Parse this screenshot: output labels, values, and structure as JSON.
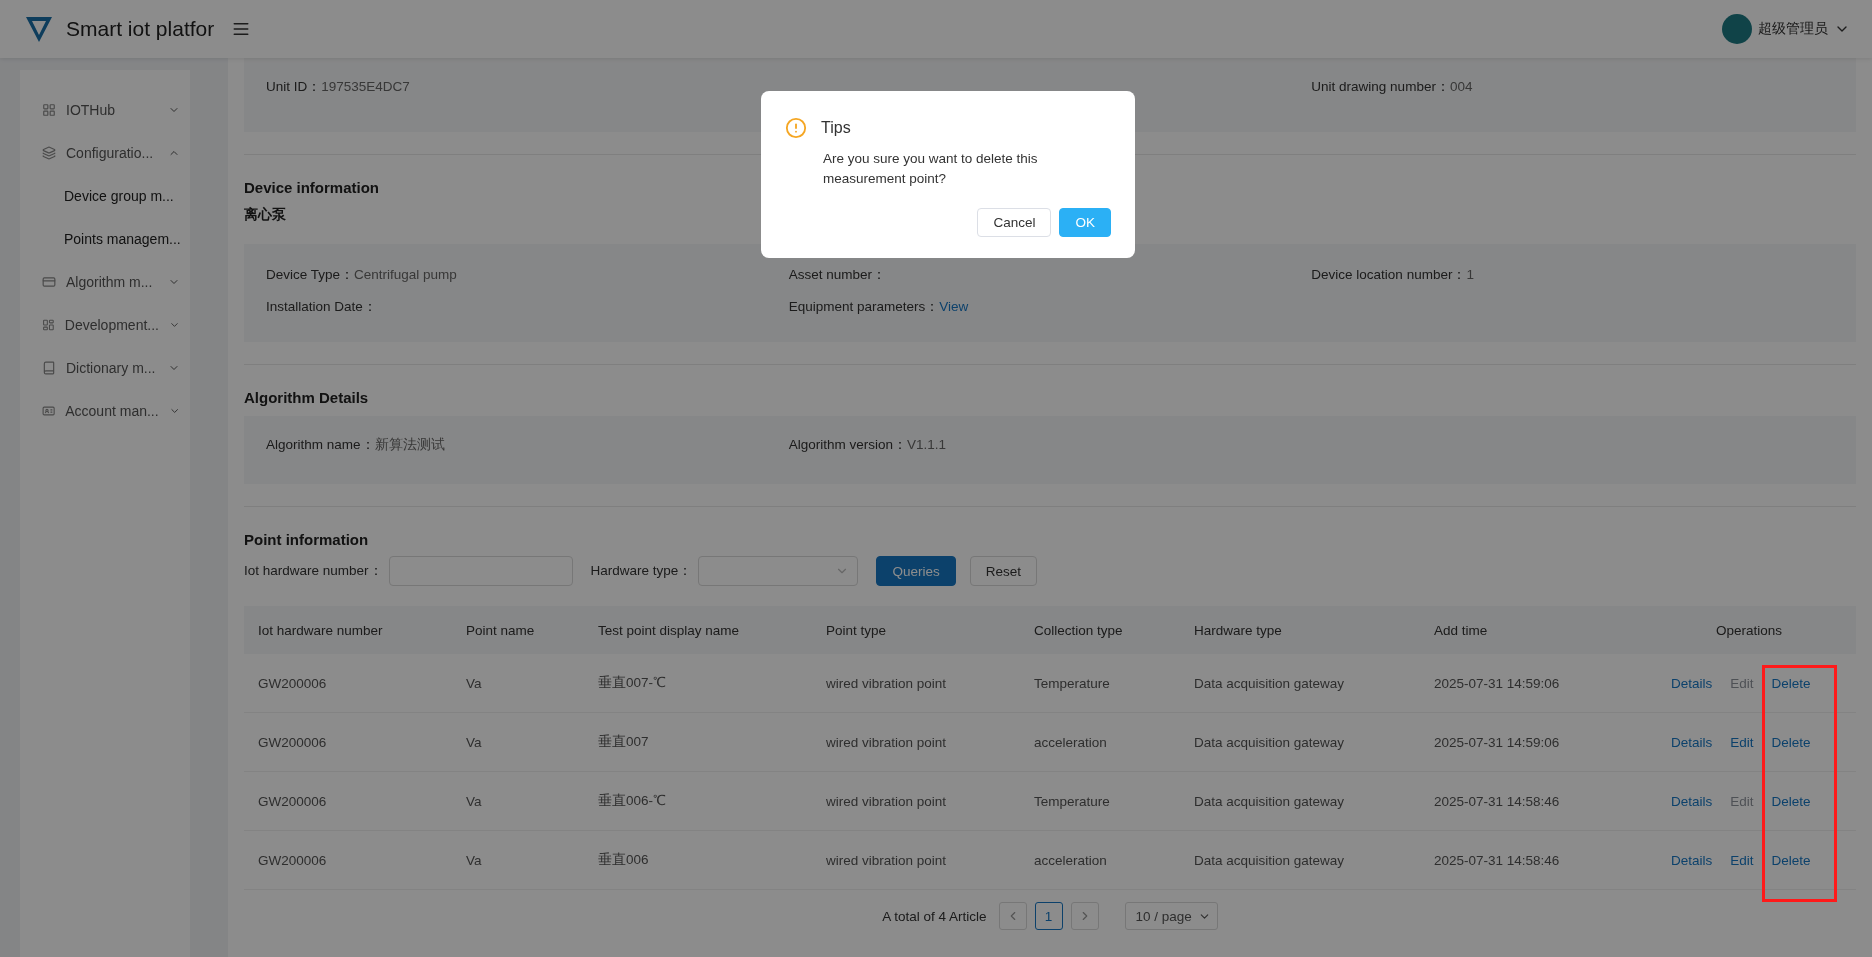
{
  "header": {
    "title": "Smart iot platfor",
    "user": "超级管理员"
  },
  "sidebar": {
    "items": [
      {
        "label": "IOTHub",
        "expanded": false
      },
      {
        "label": "Configuratio...",
        "expanded": true,
        "children": [
          {
            "label": "Device group m..."
          },
          {
            "label": "Points managem..."
          }
        ]
      },
      {
        "label": "Algorithm m...",
        "expanded": false
      },
      {
        "label": "Development...",
        "expanded": false
      },
      {
        "label": "Dictionary m...",
        "expanded": false
      },
      {
        "label": "Account man...",
        "expanded": false
      }
    ]
  },
  "unit": {
    "fields": [
      {
        "label": "Unit ID：",
        "value": "197535E4DC7"
      },
      {
        "label": "Unit drawing number：",
        "value": "004"
      }
    ]
  },
  "device": {
    "heading": "Device information",
    "name": "离心泵",
    "fields": [
      {
        "label": "Device Type：",
        "value": "Centrifugal pump"
      },
      {
        "label": "Asset number："
      },
      {
        "label": "Device location number：",
        "value": "1"
      },
      {
        "label": "Installation Date："
      },
      {
        "label": "Equipment parameters：",
        "link": "View"
      }
    ]
  },
  "algorithm": {
    "heading": "Algorithm Details",
    "fields": [
      {
        "label": "Algorithm name：",
        "value": "新算法测试"
      },
      {
        "label": "Algorithm version：",
        "value": "V1.1.1"
      }
    ]
  },
  "points": {
    "heading": "Point information",
    "filters": [
      {
        "label": "Iot hardware number：",
        "kind": "input"
      },
      {
        "label": "Hardware type：",
        "kind": "select"
      }
    ],
    "buttons": [
      {
        "label": "Queries",
        "kind": "primary"
      },
      {
        "label": "Reset",
        "kind": "default"
      }
    ],
    "table": {
      "columns": [
        "Iot hardware number",
        "Point name",
        "Test point display name",
        "Point type",
        "Collection type",
        "Hardware type",
        "Add time",
        "Operations"
      ],
      "rows": [
        {
          "cells": [
            "GW200006",
            "Va",
            "垂直007-℃",
            "wired vibration point",
            "Temperature",
            "Data acquisition gateway",
            "2025-07-31 14:59:06"
          ],
          "actions": [
            {
              "label": "Details",
              "disabled": false
            },
            {
              "label": "Edit",
              "disabled": true
            },
            {
              "label": "Delete",
              "disabled": false
            }
          ]
        },
        {
          "cells": [
            "GW200006",
            "Va",
            "垂直007",
            "wired vibration point",
            "acceleration",
            "Data acquisition gateway",
            "2025-07-31 14:59:06"
          ],
          "actions": [
            {
              "label": "Details",
              "disabled": false
            },
            {
              "label": "Edit",
              "disabled": false
            },
            {
              "label": "Delete",
              "disabled": false
            }
          ]
        },
        {
          "cells": [
            "GW200006",
            "Va",
            "垂直006-℃",
            "wired vibration point",
            "Temperature",
            "Data acquisition gateway",
            "2025-07-31 14:58:46"
          ],
          "actions": [
            {
              "label": "Details",
              "disabled": false
            },
            {
              "label": "Edit",
              "disabled": true
            },
            {
              "label": "Delete",
              "disabled": false
            }
          ]
        },
        {
          "cells": [
            "GW200006",
            "Va",
            "垂直006",
            "wired vibration point",
            "acceleration",
            "Data acquisition gateway",
            "2025-07-31 14:58:46"
          ],
          "actions": [
            {
              "label": "Details",
              "disabled": false
            },
            {
              "label": "Edit",
              "disabled": false
            },
            {
              "label": "Delete",
              "disabled": false
            }
          ]
        }
      ]
    },
    "pagination": {
      "total": "A total of 4 Article",
      "pages": [
        {
          "label": "1",
          "selected": true
        }
      ],
      "size": "10 / page"
    }
  },
  "modal": {
    "title": "Tips",
    "message": "Are you sure you want to delete this measurement point?",
    "buttons": [
      {
        "label": "Cancel",
        "kind": "default"
      },
      {
        "label": "OK",
        "kind": "primary"
      }
    ]
  }
}
